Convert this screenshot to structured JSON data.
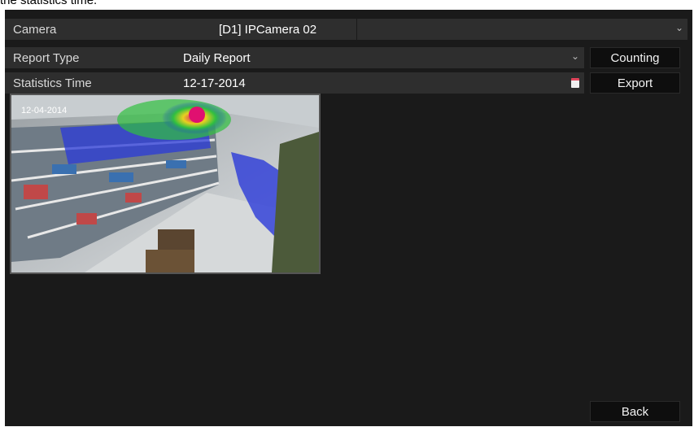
{
  "caption": "the statistics time.",
  "camera": {
    "label": "Camera",
    "value": "[D1] IPCamera 02"
  },
  "report_type": {
    "label": "Report Type",
    "value": "Daily Report"
  },
  "statistics_time": {
    "label": "Statistics Time",
    "value": "12-17-2014"
  },
  "buttons": {
    "counting": "Counting",
    "export": "Export",
    "back": "Back"
  },
  "thumbnail": {
    "timestamp": "12-04-2014"
  },
  "icons": {
    "dropdown": "chevron-down-icon",
    "calendar": "calendar-icon"
  }
}
